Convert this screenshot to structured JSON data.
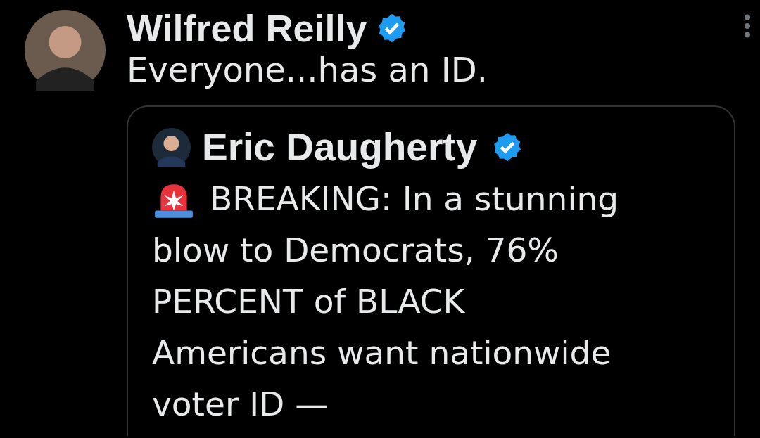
{
  "post": {
    "author": {
      "name": "Wilfred Reilly",
      "verified": true
    },
    "text": "Everyone...has an ID.",
    "quoted_post": {
      "author": {
        "name": "Eric Daugherty",
        "verified": true
      },
      "text_lines": [
        "BREAKING: In a stunning",
        "blow to Democrats, 76%",
        "PERCENT of BLACK",
        "Americans want nationwide",
        "voter ID —"
      ]
    }
  }
}
